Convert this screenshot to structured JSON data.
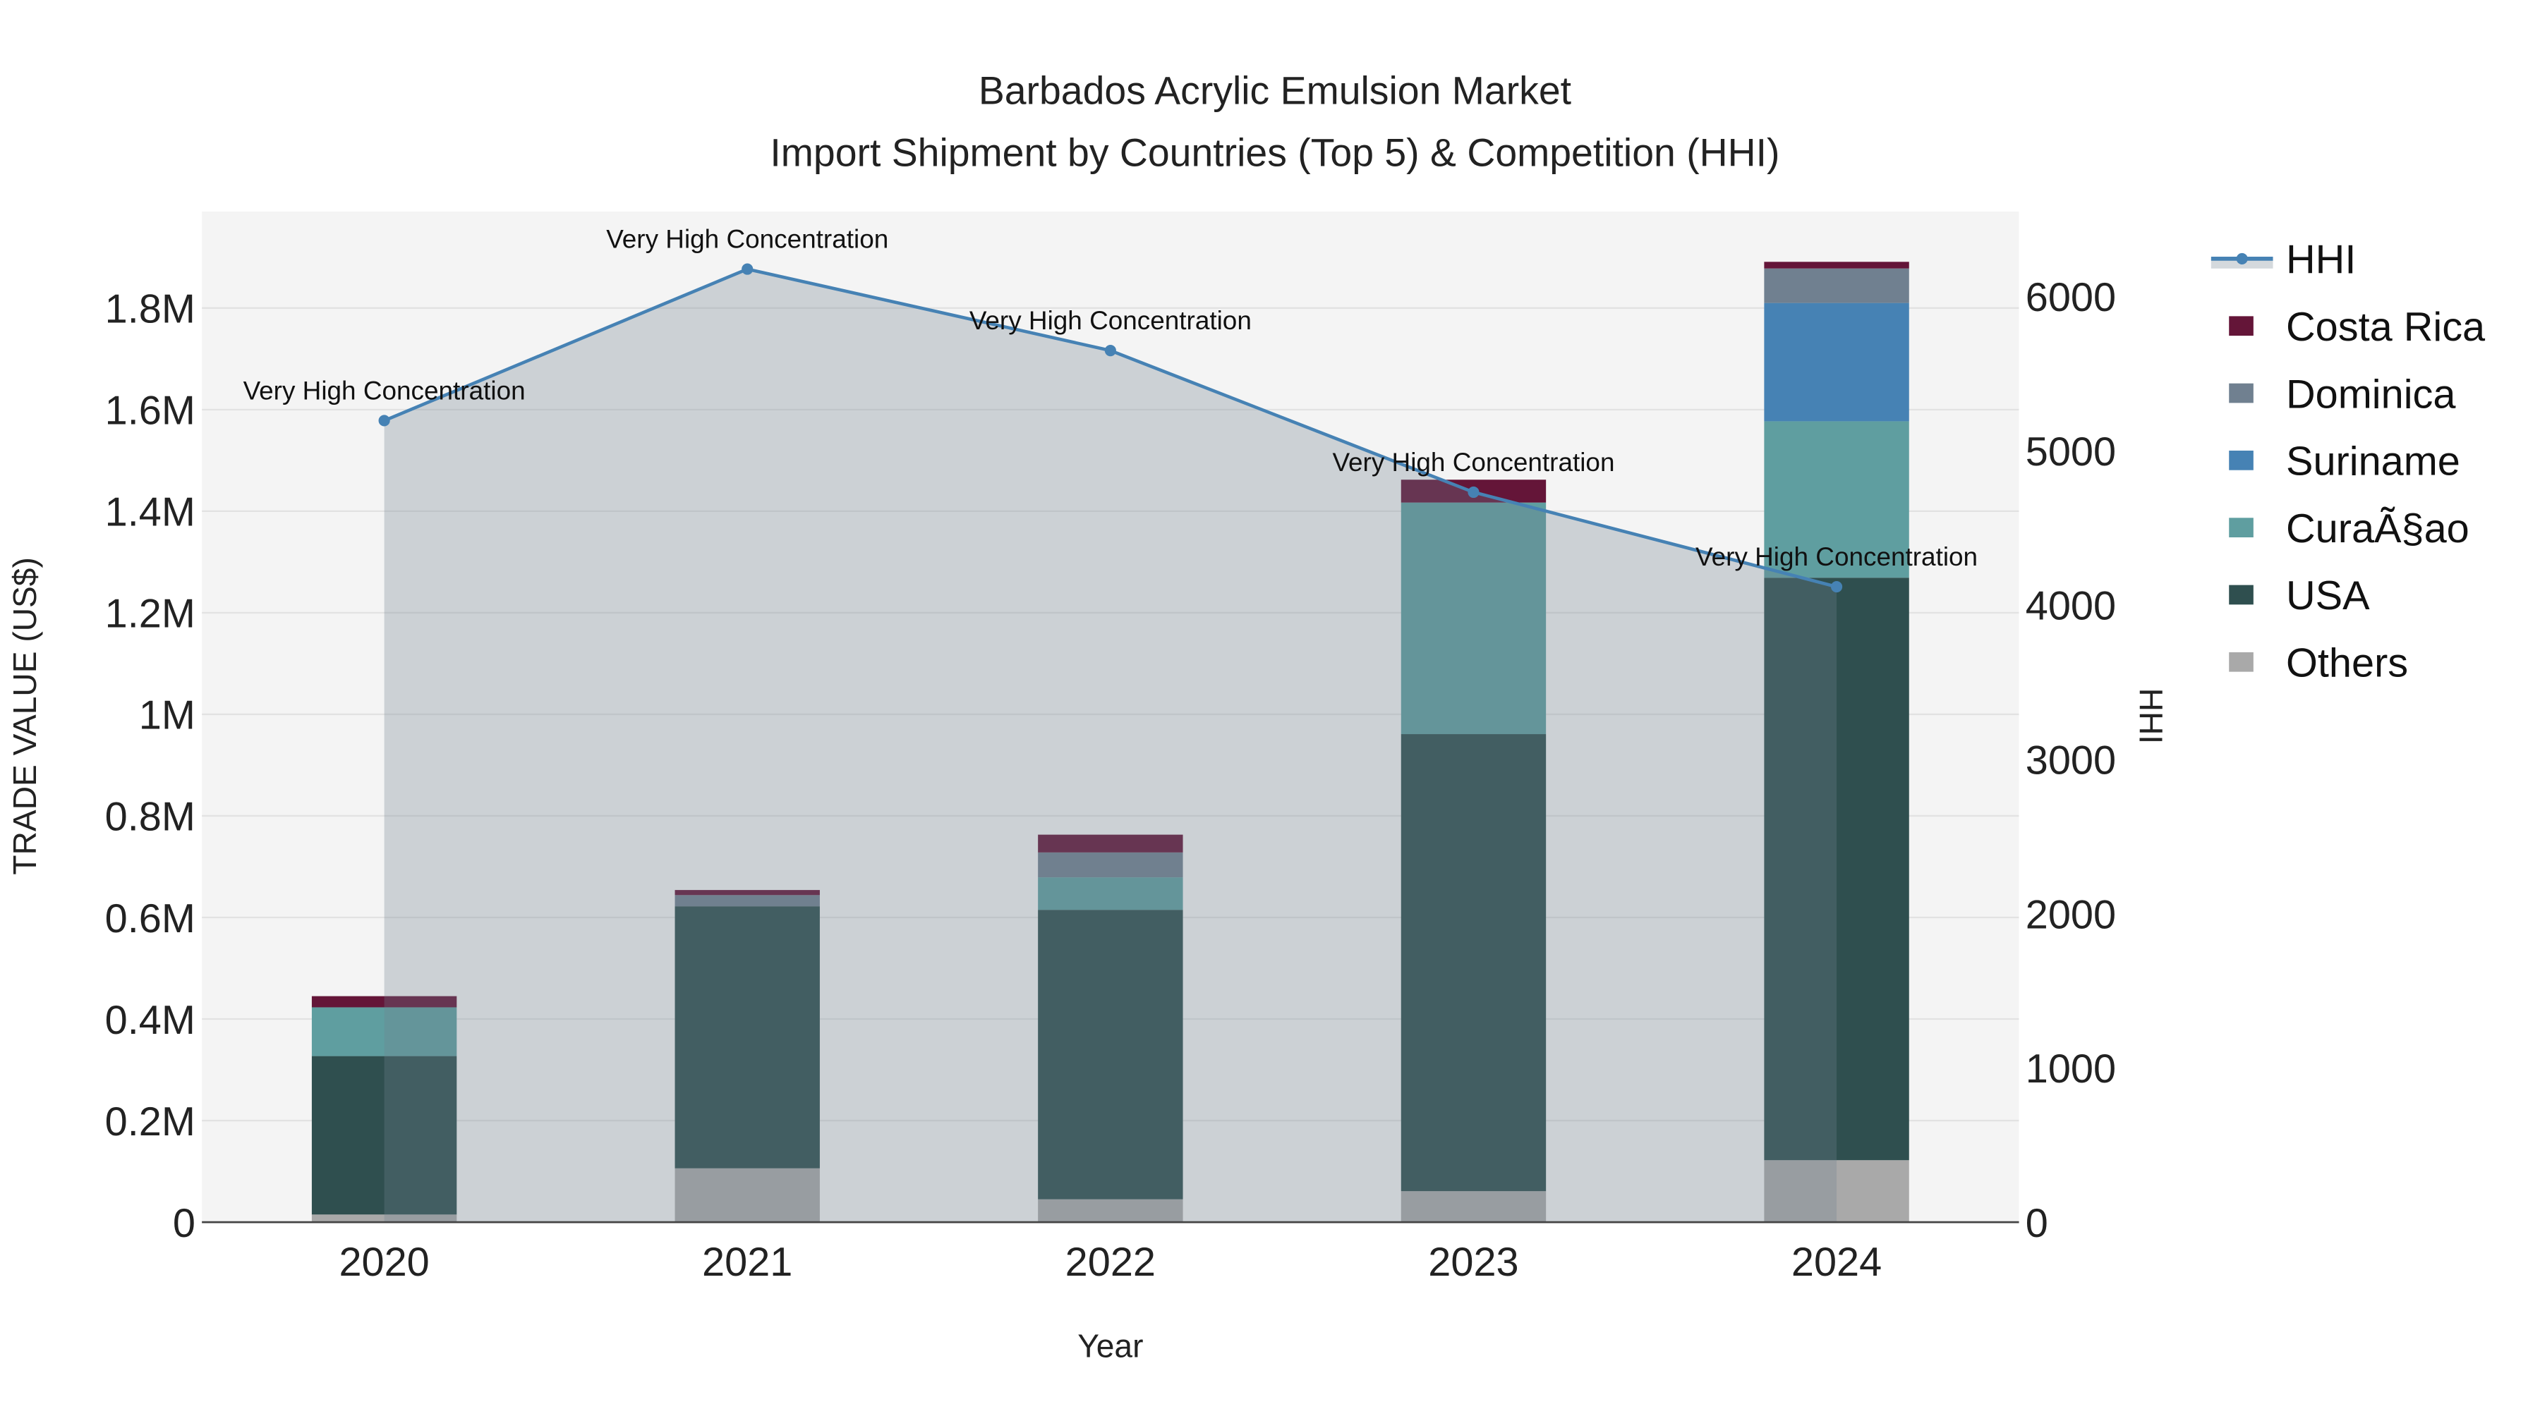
{
  "chart_data": {
    "type": "bar",
    "title": "Barbados Acrylic Emulsion Market",
    "subtitle": "Import Shipment by Countries (Top 5) & Competition (HHI)",
    "xlabel": "Year",
    "ylabel": "TRADE VALUE (US$)",
    "y2label": "HHI",
    "categories": [
      "2020",
      "2021",
      "2022",
      "2023",
      "2024"
    ],
    "ylim": [
      0,
      1990000
    ],
    "y2lim": [
      0,
      6550
    ],
    "yticks": [
      0,
      200000,
      400000,
      600000,
      800000,
      1000000,
      1200000,
      1400000,
      1600000,
      1800000
    ],
    "ytick_labels": [
      "0",
      "0.2M",
      "0.4M",
      "0.6M",
      "0.8M",
      "1M",
      "1.2M",
      "1.4M",
      "1.6M",
      "1.8M"
    ],
    "y2ticks": [
      0,
      1000,
      2000,
      3000,
      4000,
      5000,
      6000
    ],
    "y2tick_labels": [
      "0",
      "1000",
      "2000",
      "3000",
      "4000",
      "5000",
      "6000"
    ],
    "grid": true,
    "stacked": true,
    "legend_position": "right",
    "series": [
      {
        "name": "Others",
        "color": "#a9a9a9",
        "values": [
          15000,
          106000,
          45000,
          61000,
          122000
        ]
      },
      {
        "name": "USA",
        "color": "#2f4f4f",
        "values": [
          312000,
          516000,
          570000,
          900000,
          1147000
        ]
      },
      {
        "name": "CuraÃ§ao",
        "color": "#5f9ea0",
        "values": [
          96000,
          0,
          64000,
          456000,
          308000
        ]
      },
      {
        "name": "Suriname",
        "color": "#4682b4",
        "values": [
          0,
          0,
          0,
          0,
          233000
        ]
      },
      {
        "name": "Dominica",
        "color": "#708090",
        "values": [
          0,
          22000,
          49000,
          0,
          68000
        ]
      },
      {
        "name": "Costa Rica",
        "color": "#641538",
        "values": [
          22000,
          10000,
          35000,
          45000,
          13000
        ]
      }
    ],
    "line": {
      "name": "HHI",
      "color": "#4682b4",
      "values": [
        5195,
        6177,
        5649,
        4731,
        4118
      ],
      "annotations": [
        "Very High Concentration",
        "Very High Concentration",
        "Very High Concentration",
        "Very High Concentration",
        "Very High Concentration"
      ]
    },
    "legend_order": [
      "HHI",
      "Costa Rica",
      "Dominica",
      "Suriname",
      "CuraÃ§ao",
      "USA",
      "Others"
    ]
  }
}
